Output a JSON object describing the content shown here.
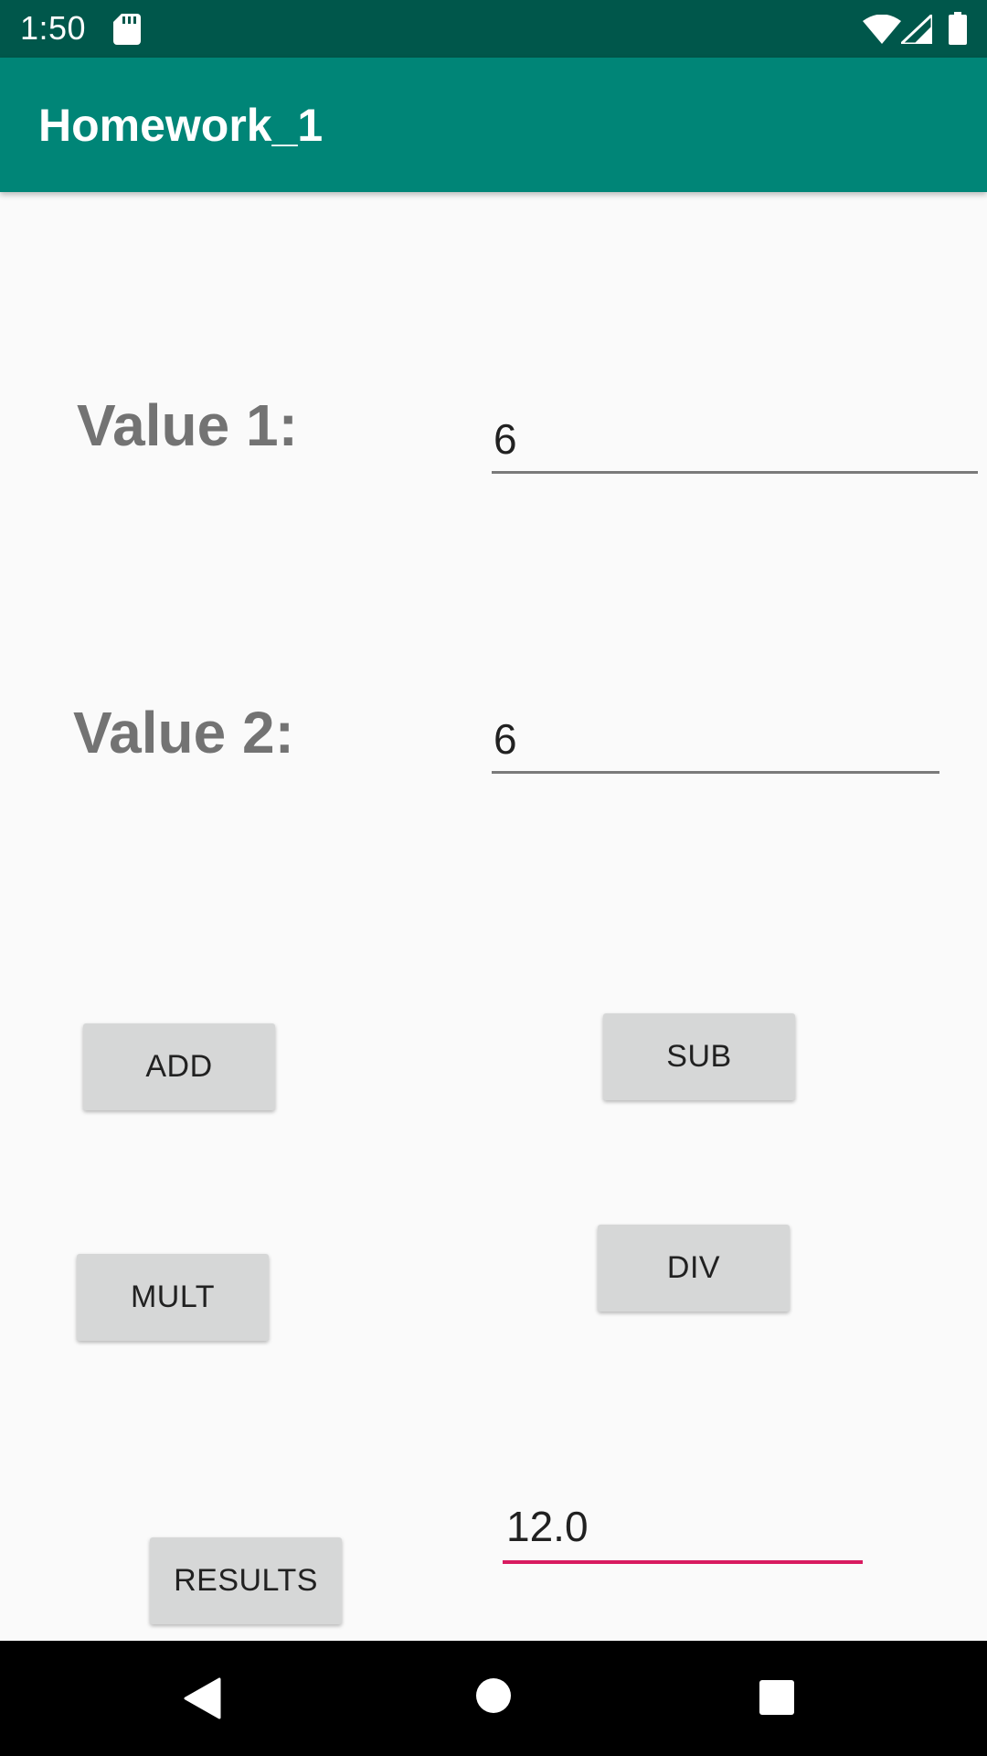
{
  "status_bar": {
    "time": "1:50",
    "icons": [
      "sd-card-icon",
      "wifi-icon",
      "cell-signal-icon",
      "battery-icon"
    ]
  },
  "app_bar": {
    "title": "Homework_1",
    "color": "#008577",
    "status_color": "#00574b"
  },
  "form": {
    "value1_label": "Value 1:",
    "value1": "6",
    "value2_label": "Value 2:",
    "value2": "6"
  },
  "buttons": {
    "add": "ADD",
    "sub": "SUB",
    "mult": "MULT",
    "div": "DIV",
    "results": "RESULTS"
  },
  "result": {
    "value": "12.0",
    "accent_color": "#d81b60"
  },
  "nav_bar": {
    "icons": [
      "back-icon",
      "home-icon",
      "recents-icon"
    ]
  }
}
